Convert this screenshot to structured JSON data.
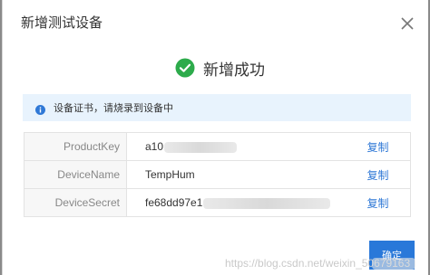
{
  "dialog": {
    "title": "新增测试设备",
    "close_icon": "close-icon"
  },
  "success": {
    "icon": "check-circle-icon",
    "message": "新增成功",
    "icon_color": "#2dab4b"
  },
  "notice": {
    "icon": "info-icon",
    "text": "设备证书，请烧录到设备中"
  },
  "credentials": {
    "rows": [
      {
        "key": "ProductKey",
        "value": "a10",
        "copy_label": "复制"
      },
      {
        "key": "DeviceName",
        "value": "TempHum",
        "copy_label": "复制"
      },
      {
        "key": "DeviceSecret",
        "value": "fe68dd97e1",
        "copy_label": "复制"
      }
    ]
  },
  "footer": {
    "confirm_label": "确定",
    "watermark": "https://blog.csdn.net/weixin_50679163"
  },
  "colors": {
    "accent": "#2978d9",
    "link": "#2f78d6",
    "notice_bg": "#e8f3fd"
  }
}
